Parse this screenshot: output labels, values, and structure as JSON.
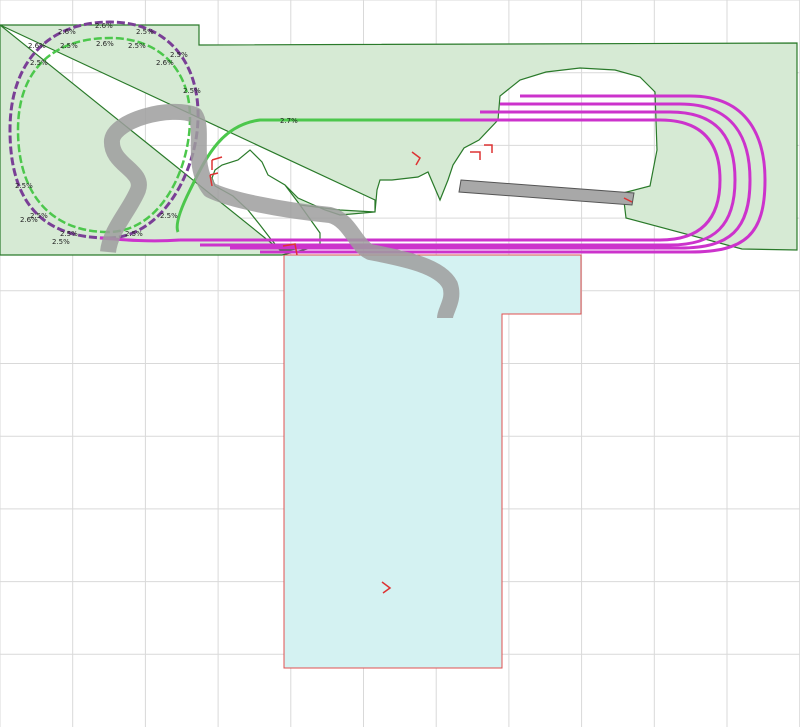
{
  "colors": {
    "background": "#ffffff",
    "grid": "#d9d9d9",
    "upper_level_fill": "#d6ead4",
    "upper_level_stroke": "#2a7a2a",
    "lower_level_fill": "#d4f2f2",
    "lower_level_stroke": "#e05050",
    "helix_track": "#7a3f96",
    "green_track": "#4cc74c",
    "magenta_track": "#cc33cc",
    "road": "#9e9e9e",
    "structure": "#a8a8a8",
    "marker": "#dd3333"
  },
  "grade_labels": [
    {
      "id": "g1",
      "text": "2.6%"
    },
    {
      "id": "g2",
      "text": "2.6%"
    },
    {
      "id": "g3",
      "text": "2.5%"
    },
    {
      "id": "g4",
      "text": "2.6%"
    },
    {
      "id": "g5",
      "text": "2.5%"
    },
    {
      "id": "g6",
      "text": "2.5%"
    },
    {
      "id": "g7",
      "text": "2.6%"
    },
    {
      "id": "g8",
      "text": "2.5%"
    },
    {
      "id": "g9",
      "text": "2.6%"
    },
    {
      "id": "g10",
      "text": "2.5%"
    },
    {
      "id": "g11",
      "text": "2.5%"
    },
    {
      "id": "g12",
      "text": "2.5%"
    },
    {
      "id": "g13",
      "text": "2.5%"
    },
    {
      "id": "g14",
      "text": "2.6%"
    },
    {
      "id": "g15",
      "text": "2.5%"
    },
    {
      "id": "g16",
      "text": "2.5%"
    },
    {
      "id": "g17",
      "text": "2.5%"
    },
    {
      "id": "g18",
      "text": "2.5%"
    },
    {
      "id": "g19",
      "text": "2.7%"
    }
  ]
}
